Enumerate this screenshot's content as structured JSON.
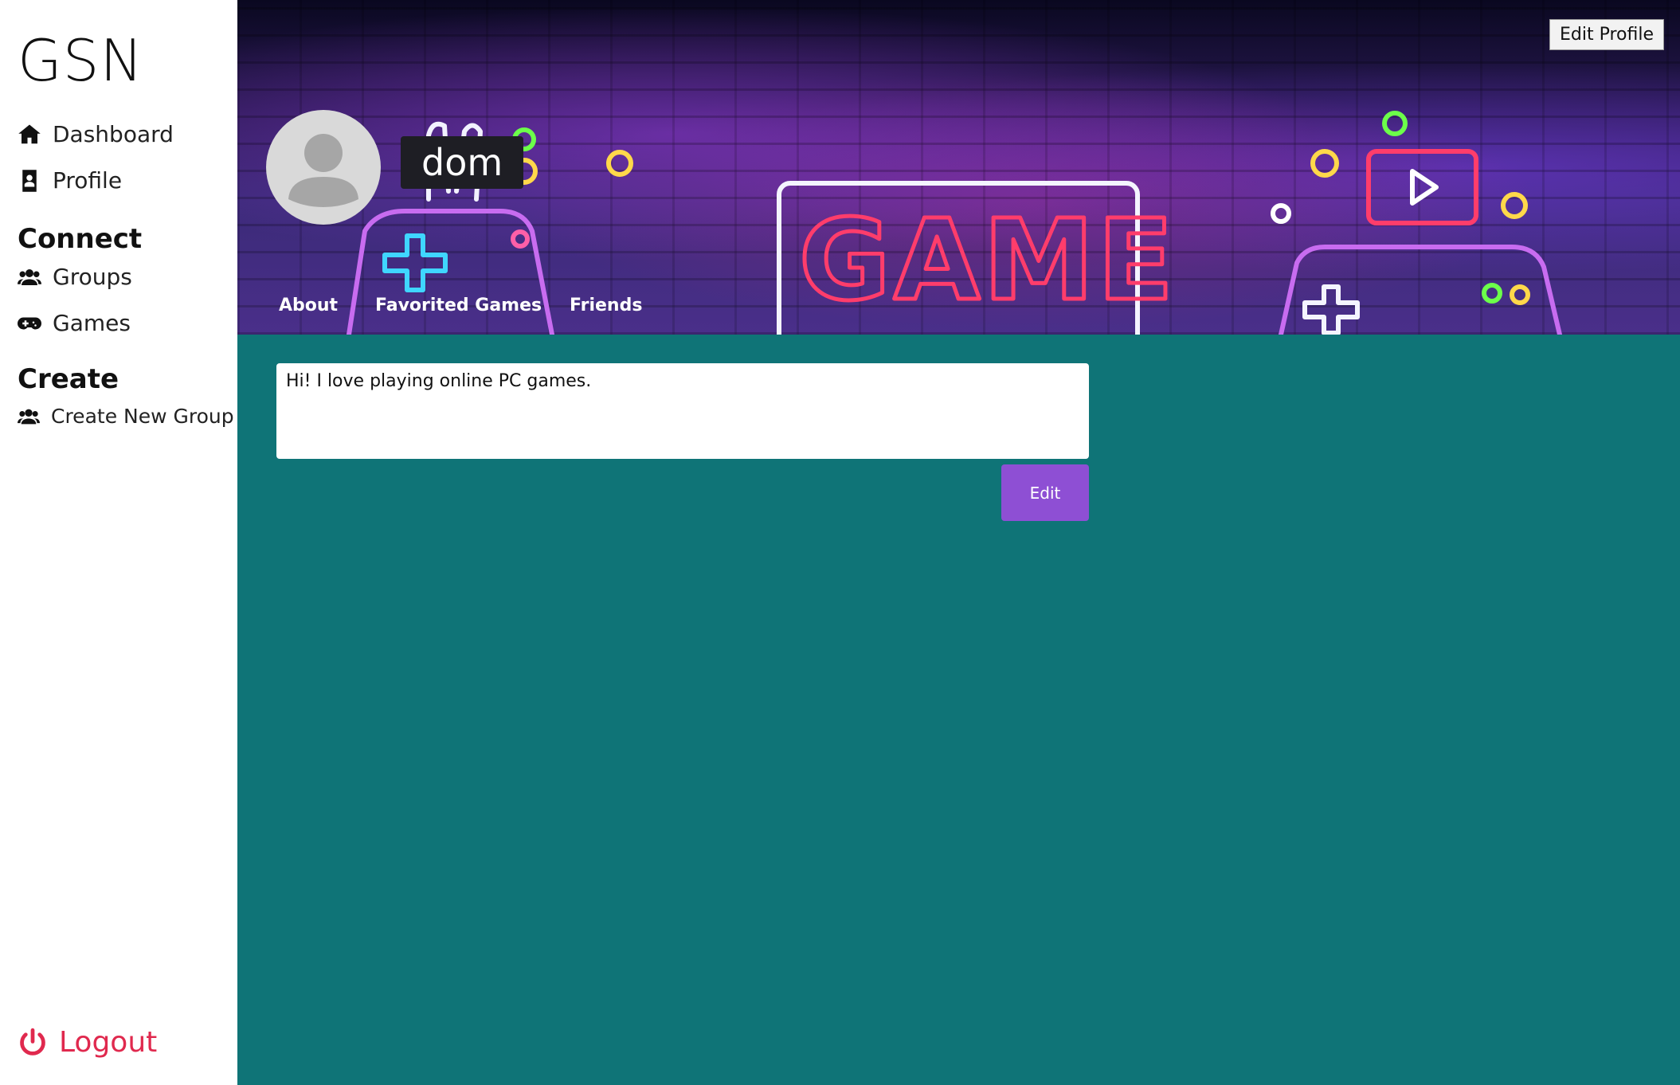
{
  "brand": "GSN",
  "sidebar": {
    "items": [
      {
        "label": "Dashboard",
        "icon": "home-icon"
      },
      {
        "label": "Profile",
        "icon": "id-card-icon"
      }
    ],
    "connect": {
      "title": "Connect",
      "items": [
        {
          "label": "Groups",
          "icon": "users-icon"
        },
        {
          "label": "Games",
          "icon": "gamepad-icon"
        }
      ]
    },
    "create": {
      "title": "Create",
      "items": [
        {
          "label": "Create New Group",
          "icon": "users-icon"
        }
      ]
    },
    "logout": "Logout"
  },
  "banner": {
    "edit_profile": "Edit Profile",
    "username": "dom",
    "tabs": [
      "About",
      "Favorited Games",
      "Friends"
    ]
  },
  "about": {
    "bio": "Hi! I love playing online PC games.",
    "edit_label": "Edit"
  },
  "colors": {
    "background": "#0f7477",
    "accent": "#8e4fd4",
    "logout": "#e0294e"
  }
}
